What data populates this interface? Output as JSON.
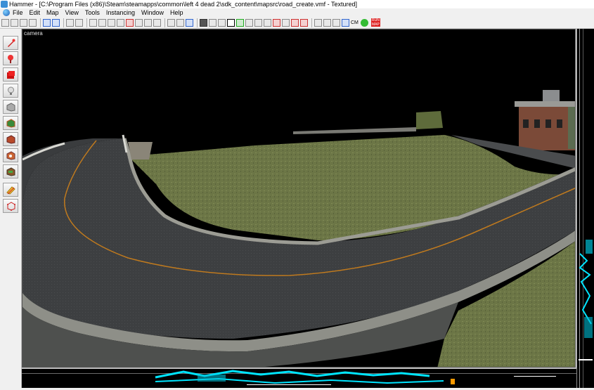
{
  "window": {
    "title": "Hammer - [C:\\Program Files (x86)\\Steam\\steamapps\\common\\left 4 dead 2\\sdk_content\\mapsrc\\road_create.vmf - Textured]"
  },
  "menu": {
    "items": [
      "File",
      "Edit",
      "Map",
      "View",
      "Tools",
      "Instancing",
      "Window",
      "Help"
    ]
  },
  "toolbar": {
    "cm_label": "CM",
    "run_label": "RUN MAP"
  },
  "viewport": {
    "camera_label": "camera"
  },
  "tools": [
    "selection-tool",
    "magnify-tool",
    "camera-tool",
    "entity-tool",
    "block-tool",
    "texture-tool",
    "apply-texture-tool",
    "decal-tool",
    "overlay-tool",
    "clipping-tool",
    "vertex-tool"
  ],
  "colors": {
    "wireframe": "#00e5ff",
    "grass": "#6f7a4a",
    "asphalt": "#3c3e40",
    "lane_line": "#c07a1e"
  }
}
